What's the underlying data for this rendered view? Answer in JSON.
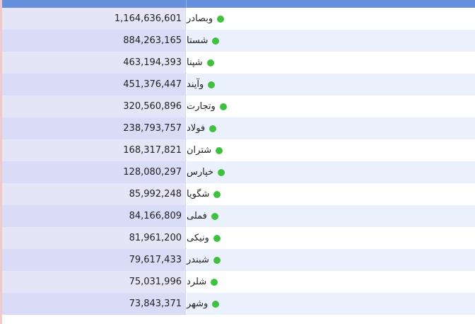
{
  "table": {
    "header": {
      "value_col": "",
      "symbol_col": ""
    },
    "rows": [
      {
        "symbol": "وبصادر",
        "value": "1,164,636,601",
        "status_color": "#3fc13f"
      },
      {
        "symbol": "شستا",
        "value": "884,263,165",
        "status_color": "#3fc13f"
      },
      {
        "symbol": "شپنا",
        "value": "463,194,393",
        "status_color": "#3fc13f"
      },
      {
        "symbol": "وآیند",
        "value": "451,376,447",
        "status_color": "#3fc13f"
      },
      {
        "symbol": "وتجارت",
        "value": "320,560,896",
        "status_color": "#3fc13f"
      },
      {
        "symbol": "فولاد",
        "value": "238,793,757",
        "status_color": "#3fc13f"
      },
      {
        "symbol": "شتران",
        "value": "168,317,821",
        "status_color": "#3fc13f"
      },
      {
        "symbol": "خپارس",
        "value": "128,080,297",
        "status_color": "#3fc13f"
      },
      {
        "symbol": "شگویا",
        "value": "85,992,248",
        "status_color": "#3fc13f"
      },
      {
        "symbol": "فملی",
        "value": "84,166,809",
        "status_color": "#3fc13f"
      },
      {
        "symbol": "ونیکی",
        "value": "81,961,200",
        "status_color": "#3fc13f"
      },
      {
        "symbol": "شبندر",
        "value": "79,617,433",
        "status_color": "#3fc13f"
      },
      {
        "symbol": "شلرد",
        "value": "75,031,996",
        "status_color": "#3fc13f"
      },
      {
        "symbol": "وشهر",
        "value": "73,843,371",
        "status_color": "#3fc13f"
      }
    ]
  },
  "colors": {
    "header_bg": "#6690dd",
    "status_dot": "#3fc13f"
  }
}
